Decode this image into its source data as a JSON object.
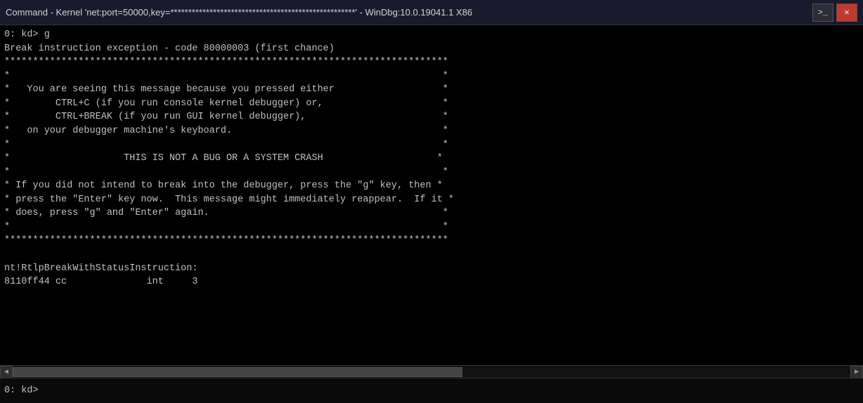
{
  "titleBar": {
    "text": "Command - Kernel 'net:port=50000,key=****************************************************' - WinDbg:10.0.19041.1 X86",
    "cmdIcon": ">_",
    "closeLabel": "✕"
  },
  "terminal": {
    "lines": [
      "0: kd> g",
      "Break instruction exception - code 80000003 (first chance)",
      "******************************************************************************",
      "*                                                                            *",
      "*   You are seeing this message because you pressed either                   *",
      "*        CTRL+C (if you run console kernel debugger) or,                     *",
      "*        CTRL+BREAK (if you run GUI kernel debugger),                        *",
      "*   on your debugger machine's keyboard.                                     *",
      "*                                                                            *",
      "*                    THIS IS NOT A BUG OR A SYSTEM CRASH                    *",
      "*                                                                            *",
      "* If you did not intend to break into the debugger, press the \"g\" key, then *",
      "* press the \"Enter\" key now.  This message might immediately reappear.  If it *",
      "* does, press \"g\" and \"Enter\" again.                                         *",
      "*                                                                            *",
      "******************************************************************************",
      "",
      "nt!RtlpBreakWithStatusInstruction:",
      "8110ff44 cc              int     3"
    ]
  },
  "inputBar": {
    "prompt": "0: kd> "
  }
}
